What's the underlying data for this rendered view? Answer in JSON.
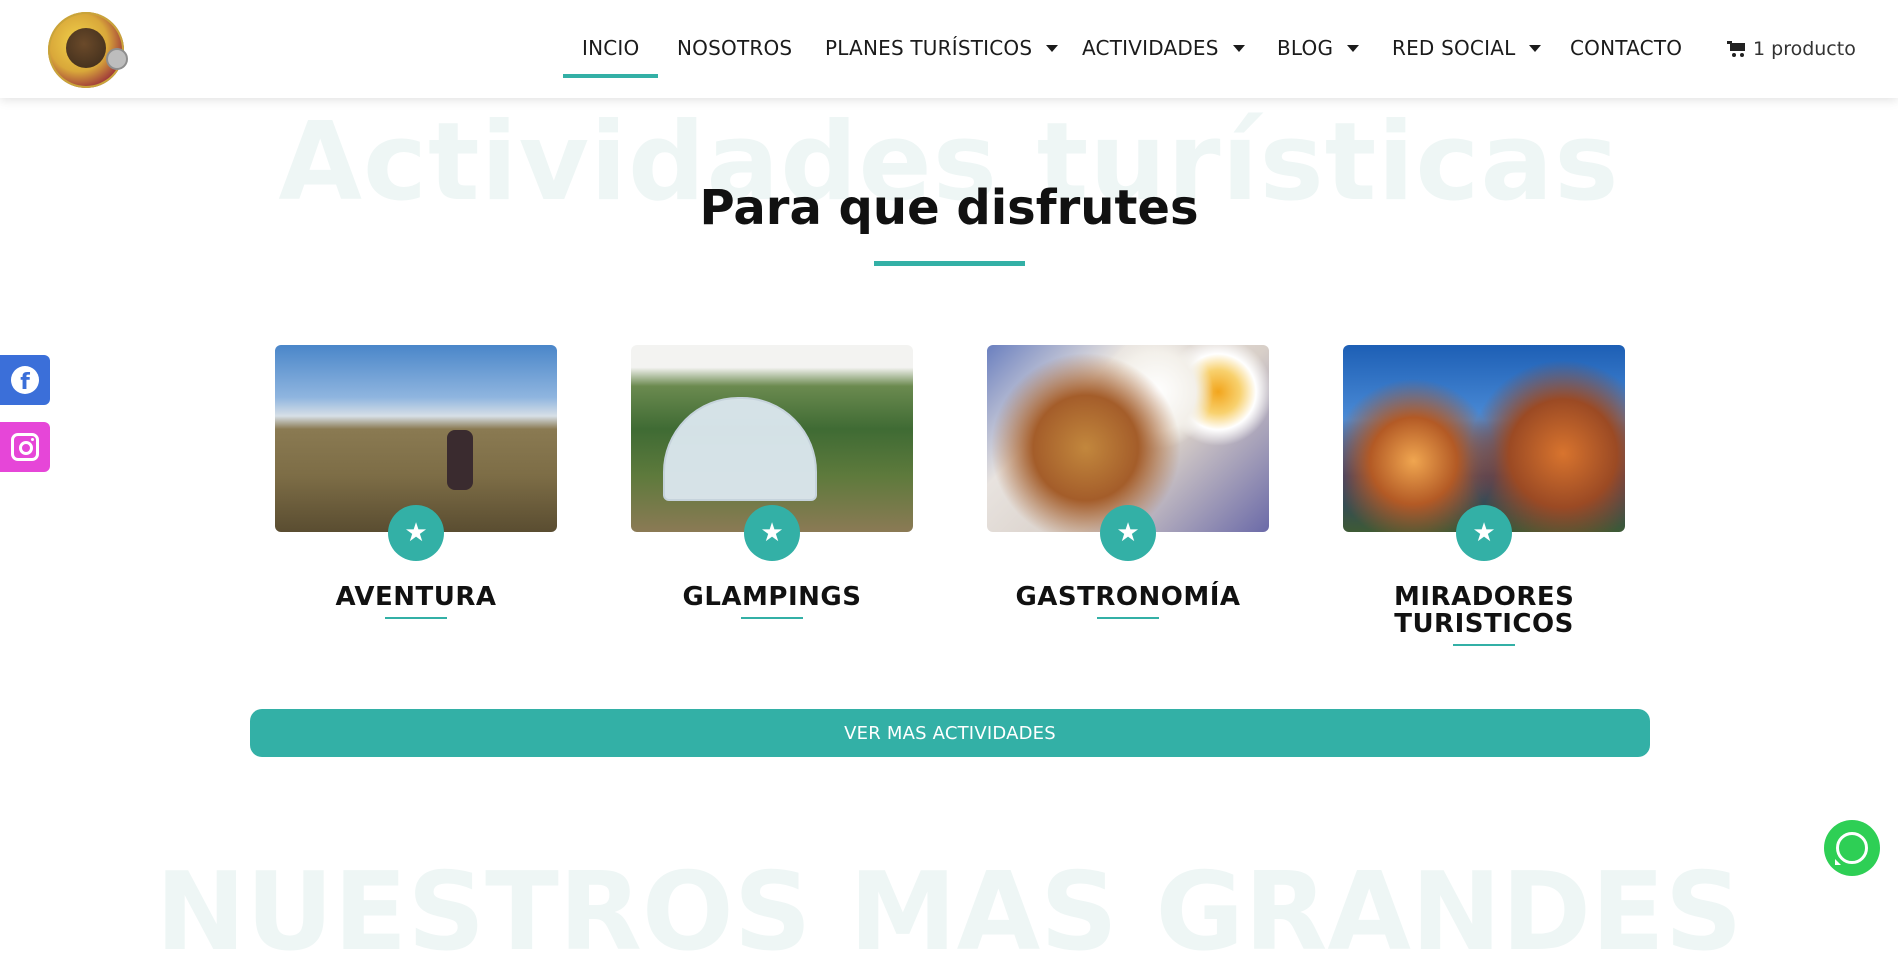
{
  "header": {
    "logo_alt": "",
    "nav": [
      {
        "label": "INCIO",
        "has_dropdown": false,
        "active": true
      },
      {
        "label": "NOSOTROS",
        "has_dropdown": false,
        "active": false
      },
      {
        "label": "PLANES TURÍSTICOS",
        "has_dropdown": true,
        "active": false
      },
      {
        "label": "ACTIVIDADES",
        "has_dropdown": true,
        "active": false
      },
      {
        "label": "BLOG",
        "has_dropdown": true,
        "active": false
      },
      {
        "label": "RED SOCIAL",
        "has_dropdown": true,
        "active": false
      },
      {
        "label": "CONTACTO",
        "has_dropdown": false,
        "active": false
      }
    ],
    "cart_label": "1 producto",
    "cart_icon": "cart-icon"
  },
  "section": {
    "background_heading": "Actividades turísticas",
    "title": "Para que disfrutes"
  },
  "social": {
    "facebook_icon": "facebook-icon",
    "instagram_icon": "instagram-icon"
  },
  "cards": [
    {
      "title": "AVENTURA",
      "icon": "star-icon"
    },
    {
      "title": "GLAMPINGS",
      "icon": "star-icon"
    },
    {
      "title": "GASTRONOMÍA",
      "icon": "star-icon"
    },
    {
      "title": "MIRADORES TURISTICOS",
      "icon": "star-icon"
    }
  ],
  "cta": {
    "label": "VER MAS ACTIVIDADES"
  },
  "next_section": {
    "background_heading": "NUESTROS MAS GRANDES"
  },
  "colors": {
    "accent": "#33b0a6",
    "facebook": "#3b6fd9",
    "instagram": "#e646d8",
    "whatsapp": "#2ecf55"
  },
  "whatsapp_icon": "whatsapp-icon"
}
